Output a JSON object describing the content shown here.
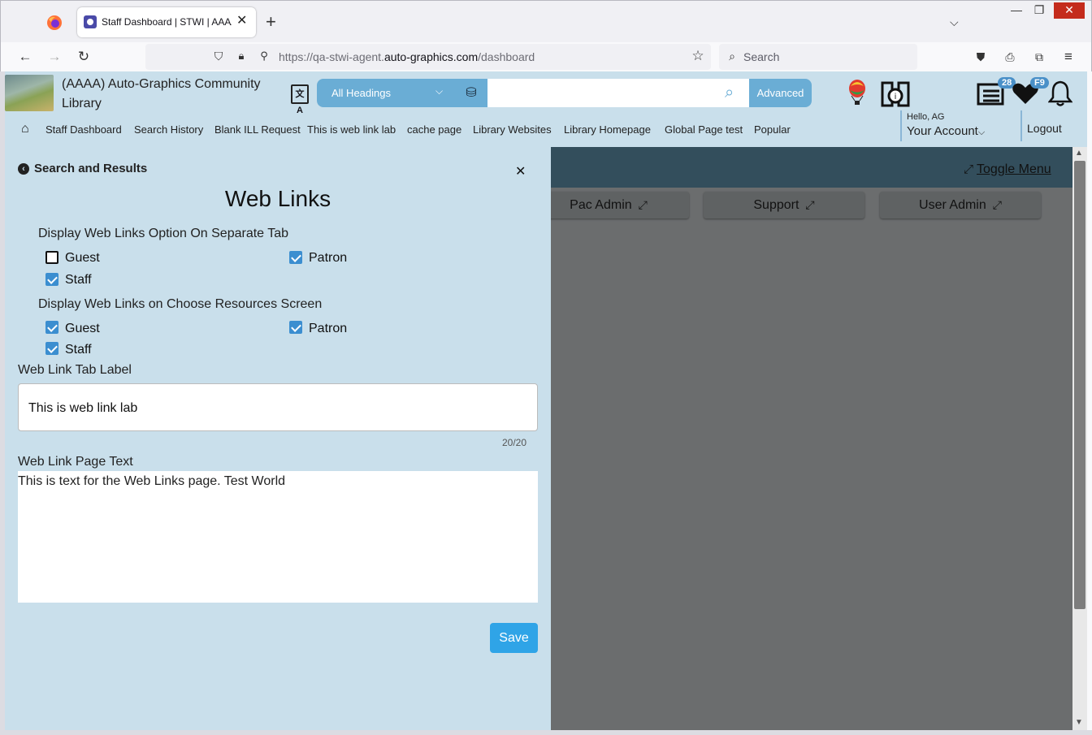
{
  "browser": {
    "tab_title": "Staff Dashboard | STWI | AAAA",
    "tab_close": "✕",
    "new_tab": "+",
    "tab_list": "⌵",
    "url_prefix": "https://qa-stwi-agent.",
    "url_domain": "auto-graphics.com",
    "url_path": "/dashboard",
    "search_placeholder": "Search",
    "window_controls": [
      "—",
      "❐",
      "✕"
    ]
  },
  "header": {
    "library_name": "(AAAA) Auto-Graphics Community Library",
    "heading_select": "All Headings",
    "search_value": "",
    "advanced_label": "Advanced",
    "list_badge": "28",
    "heart_badge": "F9",
    "menu": [
      "Staff Dashboard",
      "Search History",
      "Blank ILL Request",
      "This is web link lab",
      "cache page",
      "Library Websites",
      "Library Homepage",
      "Global Page test",
      "Popular"
    ],
    "greeting": "Hello, AG",
    "account_label": "Your Account",
    "logout_label": "Logout"
  },
  "main": {
    "toggle_menu_label": "Toggle Menu",
    "admin_buttons": [
      "Pac Admin",
      "Support",
      "User Admin"
    ]
  },
  "panel": {
    "back_label": "Search and Results",
    "title": "Web Links",
    "group1_label": "Display Web Links Option On Separate Tab",
    "group1": {
      "guest": {
        "label": "Guest",
        "checked": false
      },
      "patron": {
        "label": "Patron",
        "checked": true
      },
      "staff": {
        "label": "Staff",
        "checked": true
      }
    },
    "group2_label": "Display Web Links on Choose Resources Screen",
    "group2": {
      "guest": {
        "label": "Guest",
        "checked": true
      },
      "patron": {
        "label": "Patron",
        "checked": true
      },
      "staff": {
        "label": "Staff",
        "checked": true
      }
    },
    "tab_label_field": "Web Link Tab Label",
    "tab_label_value": "This is web link lab",
    "tab_label_counter": "20/20",
    "page_text_field": "Web Link Page Text",
    "page_text_value": "This is text for the Web Links page. Test World",
    "save_label": "Save"
  }
}
